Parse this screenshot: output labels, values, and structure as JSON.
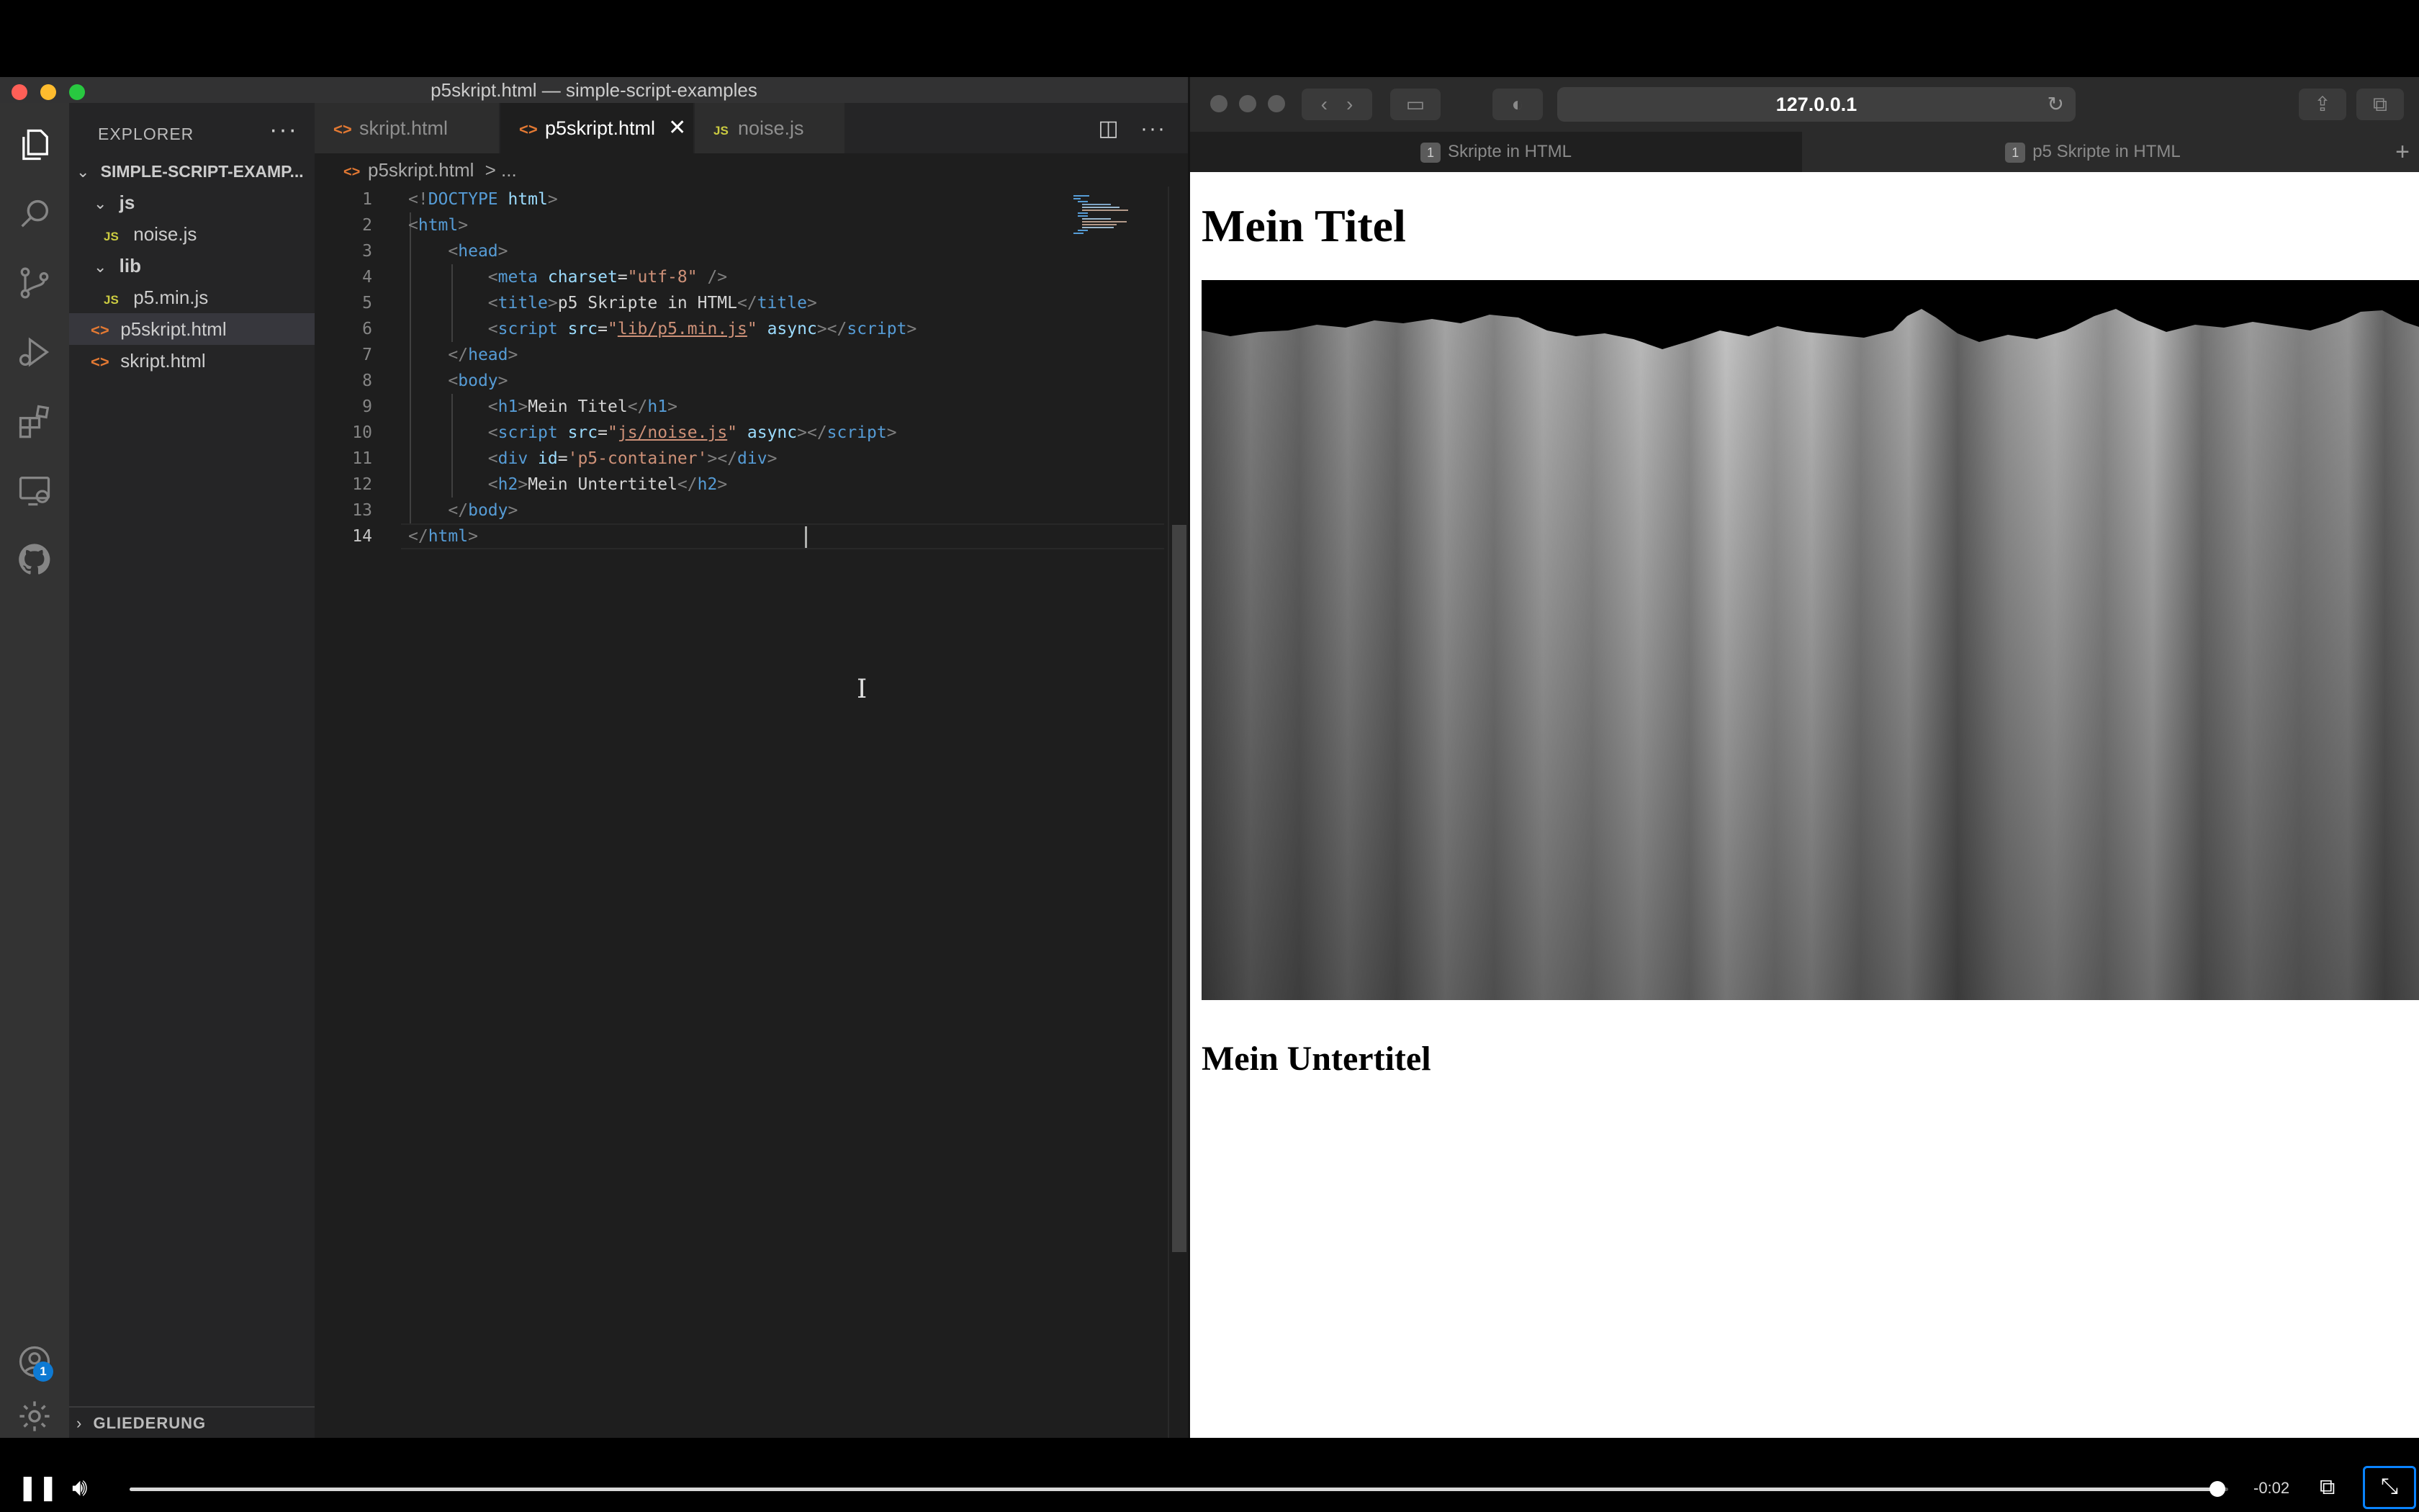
{
  "vscode": {
    "window_title": "p5skript.html — simple-script-examples",
    "explorer": {
      "title": "EXPLORER",
      "more": "···",
      "root": "SIMPLE-SCRIPT-EXAMP...",
      "items": [
        {
          "label": "js",
          "type": "folder"
        },
        {
          "label": "noise.js",
          "type": "js"
        },
        {
          "label": "lib",
          "type": "folder"
        },
        {
          "label": "p5.min.js",
          "type": "js"
        },
        {
          "label": "p5skript.html",
          "type": "html"
        },
        {
          "label": "skript.html",
          "type": "html"
        }
      ],
      "outline": "GLIEDERUNG"
    },
    "tabs": [
      {
        "label": "skript.html",
        "icon": "html"
      },
      {
        "label": "p5skript.html",
        "icon": "html",
        "active": true,
        "close": "✕"
      },
      {
        "label": "noise.js",
        "icon": "JS"
      }
    ],
    "icon_html": "<>",
    "icon_js": "JS",
    "breadcrumb": {
      "file": "p5skript.html",
      "rest": "> ..."
    },
    "code_lines": [
      [
        {
          "t": "<!",
          "c": "br"
        },
        {
          "t": "DOCTYPE",
          "c": "tag"
        },
        {
          "t": " html",
          "c": "attr"
        },
        {
          "t": ">",
          "c": "br"
        }
      ],
      [
        {
          "t": "<",
          "c": "br"
        },
        {
          "t": "html",
          "c": "tag"
        },
        {
          "t": ">",
          "c": "br"
        }
      ],
      [
        {
          "t": "    ",
          "c": "txt"
        },
        {
          "t": "<",
          "c": "br"
        },
        {
          "t": "head",
          "c": "tag"
        },
        {
          "t": ">",
          "c": "br"
        }
      ],
      [
        {
          "t": "        ",
          "c": "txt"
        },
        {
          "t": "<",
          "c": "br"
        },
        {
          "t": "meta",
          "c": "tag"
        },
        {
          "t": " charset",
          "c": "attr"
        },
        {
          "t": "=",
          "c": "txt"
        },
        {
          "t": "\"utf-8\"",
          "c": "str"
        },
        {
          "t": " />",
          "c": "br"
        }
      ],
      [
        {
          "t": "        ",
          "c": "txt"
        },
        {
          "t": "<",
          "c": "br"
        },
        {
          "t": "title",
          "c": "tag"
        },
        {
          "t": ">",
          "c": "br"
        },
        {
          "t": "p5 Skripte in HTML",
          "c": "txt"
        },
        {
          "t": "</",
          "c": "br"
        },
        {
          "t": "title",
          "c": "tag"
        },
        {
          "t": ">",
          "c": "br"
        }
      ],
      [
        {
          "t": "        ",
          "c": "txt"
        },
        {
          "t": "<",
          "c": "br"
        },
        {
          "t": "script",
          "c": "tag"
        },
        {
          "t": " src",
          "c": "attr"
        },
        {
          "t": "=",
          "c": "txt"
        },
        {
          "t": "\"",
          "c": "str"
        },
        {
          "t": "lib/p5.min.js",
          "c": "link"
        },
        {
          "t": "\"",
          "c": "str"
        },
        {
          "t": " async",
          "c": "attr"
        },
        {
          "t": "></",
          "c": "br"
        },
        {
          "t": "script",
          "c": "tag"
        },
        {
          "t": ">",
          "c": "br"
        }
      ],
      [
        {
          "t": "    ",
          "c": "txt"
        },
        {
          "t": "</",
          "c": "br"
        },
        {
          "t": "head",
          "c": "tag"
        },
        {
          "t": ">",
          "c": "br"
        }
      ],
      [
        {
          "t": "    ",
          "c": "txt"
        },
        {
          "t": "<",
          "c": "br"
        },
        {
          "t": "body",
          "c": "tag"
        },
        {
          "t": ">",
          "c": "br"
        }
      ],
      [
        {
          "t": "        ",
          "c": "txt"
        },
        {
          "t": "<",
          "c": "br"
        },
        {
          "t": "h1",
          "c": "tag"
        },
        {
          "t": ">",
          "c": "br"
        },
        {
          "t": "Mein Titel",
          "c": "txt"
        },
        {
          "t": "</",
          "c": "br"
        },
        {
          "t": "h1",
          "c": "tag"
        },
        {
          "t": ">",
          "c": "br"
        }
      ],
      [
        {
          "t": "        ",
          "c": "txt"
        },
        {
          "t": "<",
          "c": "br"
        },
        {
          "t": "script",
          "c": "tag"
        },
        {
          "t": " src",
          "c": "attr"
        },
        {
          "t": "=",
          "c": "txt"
        },
        {
          "t": "\"",
          "c": "str"
        },
        {
          "t": "js/noise.js",
          "c": "link"
        },
        {
          "t": "\"",
          "c": "str"
        },
        {
          "t": " async",
          "c": "attr"
        },
        {
          "t": "></",
          "c": "br"
        },
        {
          "t": "script",
          "c": "tag"
        },
        {
          "t": ">",
          "c": "br"
        }
      ],
      [
        {
          "t": "        ",
          "c": "txt"
        },
        {
          "t": "<",
          "c": "br"
        },
        {
          "t": "div",
          "c": "tag"
        },
        {
          "t": " id",
          "c": "attr"
        },
        {
          "t": "=",
          "c": "txt"
        },
        {
          "t": "'p5-container'",
          "c": "str"
        },
        {
          "t": "></",
          "c": "br"
        },
        {
          "t": "div",
          "c": "tag"
        },
        {
          "t": ">",
          "c": "br"
        }
      ],
      [
        {
          "t": "        ",
          "c": "txt"
        },
        {
          "t": "<",
          "c": "br"
        },
        {
          "t": "h2",
          "c": "tag"
        },
        {
          "t": ">",
          "c": "br"
        },
        {
          "t": "Mein Untertitel",
          "c": "txt"
        },
        {
          "t": "</",
          "c": "br"
        },
        {
          "t": "h2",
          "c": "tag"
        },
        {
          "t": ">",
          "c": "br"
        }
      ],
      [
        {
          "t": "    ",
          "c": "txt"
        },
        {
          "t": "</",
          "c": "br"
        },
        {
          "t": "body",
          "c": "tag"
        },
        {
          "t": ">",
          "c": "br"
        }
      ],
      [
        {
          "t": "</",
          "c": "br"
        },
        {
          "t": "html",
          "c": "tag"
        },
        {
          "t": ">",
          "c": "br"
        }
      ]
    ],
    "current_line": 14,
    "account_badge": "1"
  },
  "safari": {
    "url": "127.0.0.1",
    "tabs": [
      {
        "num": "1",
        "label": "Skripte in HTML"
      },
      {
        "num": "1",
        "label": "p5 Skripte in HTML",
        "active": true
      }
    ],
    "new_tab": "+",
    "page": {
      "h1": "Mein Titel",
      "h2": "Mein Untertitel"
    }
  },
  "player": {
    "time": "-0:02",
    "progress": 0.995
  },
  "colors": {
    "accent": "#0a84ff",
    "vscode_bg": "#1e1e1e",
    "sidebar_bg": "#252526",
    "activity_bg": "#333333"
  }
}
